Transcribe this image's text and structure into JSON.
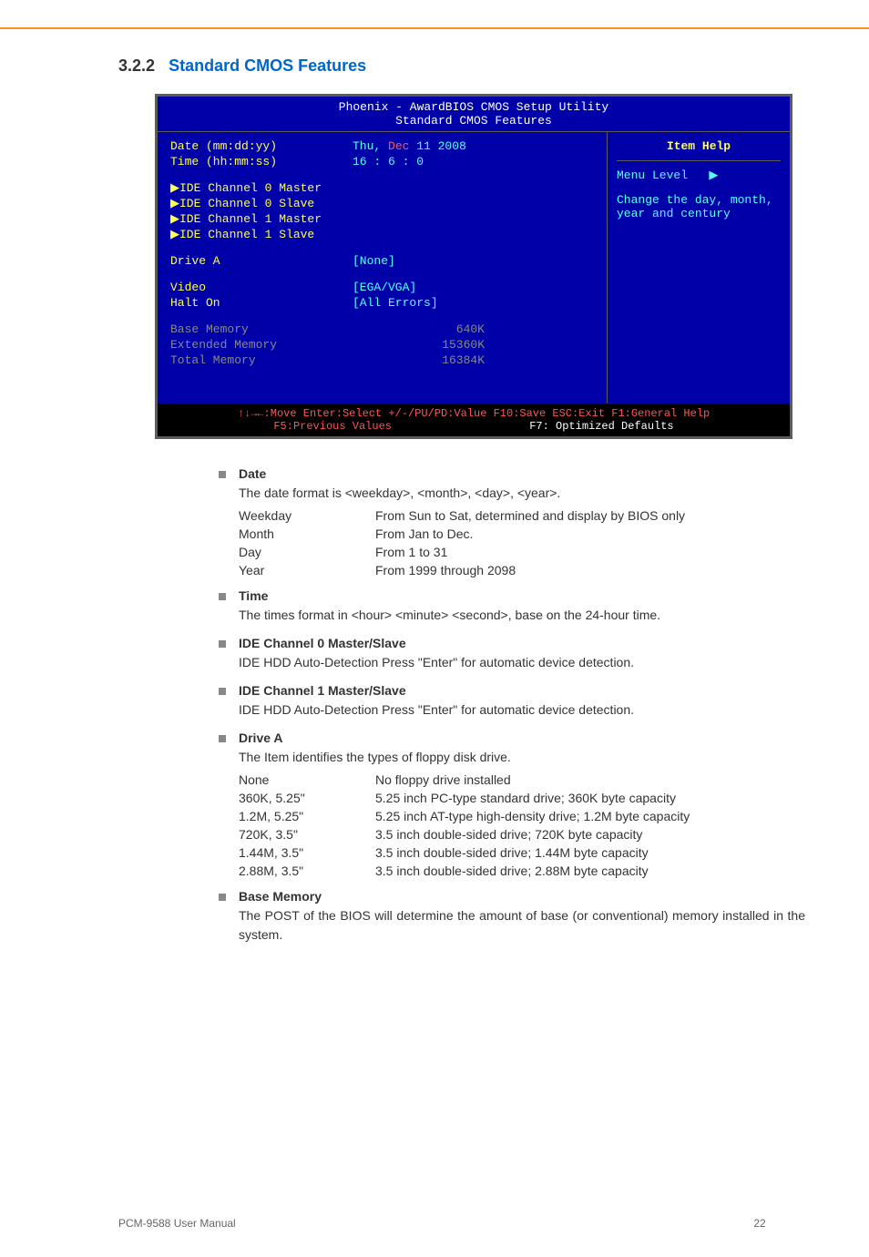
{
  "heading": {
    "number": "3.2.2",
    "title": "Standard CMOS Features"
  },
  "bios": {
    "header_line1": "Phoenix - AwardBIOS CMOS Setup Utility",
    "header_line2": "Standard CMOS Features",
    "rows": {
      "date_label": "Date (mm:dd:yy)",
      "date_value_prefix": "Thu, ",
      "date_value_month": "Dec",
      "date_value_rest": " 11 2008",
      "time_label": "Time (hh:mm:ss)",
      "time_value": "16 :  6 :  0",
      "ide0m": "IDE Channel 0 Master",
      "ide0s": "IDE Channel 0 Slave",
      "ide1m": "IDE Channel 1 Master",
      "ide1s": "IDE Channel 1 Slave",
      "drivea_label": "Drive A",
      "drivea_value": "[None]",
      "video_label": "Video",
      "video_value": "[EGA/VGA]",
      "halton_label": "Halt On",
      "halton_value": "[All Errors]",
      "basemem_label": "Base Memory",
      "basemem_value": "640K",
      "extmem_label": "Extended Memory",
      "extmem_value": "15360K",
      "totmem_label": "Total Memory",
      "totmem_value": "16384K"
    },
    "help": {
      "title": "Item Help",
      "menu_level": "Menu Level",
      "arrow": "▶",
      "help_text": "Change the day, month, year and century"
    },
    "footer": {
      "line1": "↑↓→←:Move   Enter:Select   +/-/PU/PD:Value   F10:Save   ESC:Exit   F1:General Help",
      "line2_left": "F5:Previous Values",
      "line2_right": "F7: Optimized Defaults"
    }
  },
  "items": [
    {
      "title": "Date",
      "text": "The date format is <weekday>, <month>, <day>, <year>.",
      "table": [
        {
          "k": "Weekday",
          "v": "From Sun to Sat, determined and display by BIOS only"
        },
        {
          "k": "Month",
          "v": "From Jan to Dec."
        },
        {
          "k": "Day",
          "v": "From 1 to 31"
        },
        {
          "k": "Year",
          "v": "From 1999 through 2098"
        }
      ]
    },
    {
      "title": "Time",
      "text": "The times format in <hour> <minute> <second>, base on the 24-hour time."
    },
    {
      "title": "IDE Channel 0 Master/Slave",
      "text": "IDE HDD Auto-Detection Press \"Enter\" for automatic device detection."
    },
    {
      "title": "IDE Channel 1 Master/Slave",
      "text": "IDE HDD Auto-Detection Press \"Enter\" for automatic device detection."
    },
    {
      "title": "Drive A",
      "text": "The Item identifies the types of floppy disk drive.",
      "table": [
        {
          "k": "None",
          "v": "No floppy drive installed"
        },
        {
          "k": "360K, 5.25\"",
          "v": "5.25 inch PC-type standard drive; 360K byte capacity"
        },
        {
          "k": "1.2M, 5.25\"",
          "v": "5.25 inch AT-type high-density drive; 1.2M byte capacity"
        },
        {
          "k": "720K, 3.5\"",
          "v": "3.5 inch double-sided drive; 720K byte capacity"
        },
        {
          "k": "1.44M, 3.5\"",
          "v": "3.5 inch double-sided drive; 1.44M byte capacity"
        },
        {
          "k": "2.88M, 3.5\"",
          "v": "3.5 inch double-sided drive; 2.88M byte capacity"
        }
      ]
    },
    {
      "title": " Base Memory",
      "text": "The POST of the BIOS will determine the amount of base (or conventional) memory installed in the system.",
      "justify": true
    }
  ],
  "footer": {
    "left": "PCM-9588 User Manual",
    "center": "22"
  }
}
